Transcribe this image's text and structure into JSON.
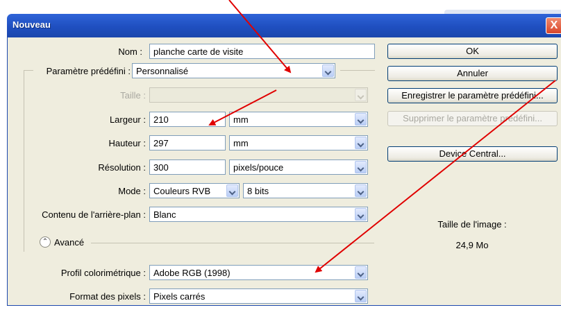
{
  "window": {
    "title": "Nouveau",
    "close_label": "X"
  },
  "form": {
    "nom": {
      "label": "Nom :",
      "value": "planche carte de visite"
    },
    "preset": {
      "label": "Paramètre prédéfini :",
      "value": "Personnalisé"
    },
    "taille": {
      "label": "Taille :",
      "value": ""
    },
    "largeur": {
      "label": "Largeur :",
      "value": "210",
      "unit": "mm"
    },
    "hauteur": {
      "label": "Hauteur :",
      "value": "297",
      "unit": "mm"
    },
    "resolution": {
      "label": "Résolution :",
      "value": "300",
      "unit": "pixels/pouce"
    },
    "mode": {
      "label": "Mode :",
      "value": "Couleurs RVB",
      "depth": "8 bits"
    },
    "contenu": {
      "label": "Contenu de l'arrière-plan :",
      "value": "Blanc"
    },
    "avance": {
      "label": "Avancé"
    },
    "profil": {
      "label": "Profil colorimétrique :",
      "value": "Adobe RGB (1998)"
    },
    "format": {
      "label": "Format des pixels :",
      "value": "Pixels carrés"
    }
  },
  "buttons": {
    "ok": "OK",
    "annuler": "Annuler",
    "enregistrer": "Enregistrer le paramètre prédéfini...",
    "supprimer": "Supprimer le paramètre prédéfini...",
    "device": "Device Central..."
  },
  "image_size": {
    "label": "Taille de l'image :",
    "value": "24,9 Mo"
  },
  "colors": {
    "title_bar": "#1f4fc0",
    "dialog_bg": "#efedde",
    "annotation_arrow": "#e00000"
  }
}
